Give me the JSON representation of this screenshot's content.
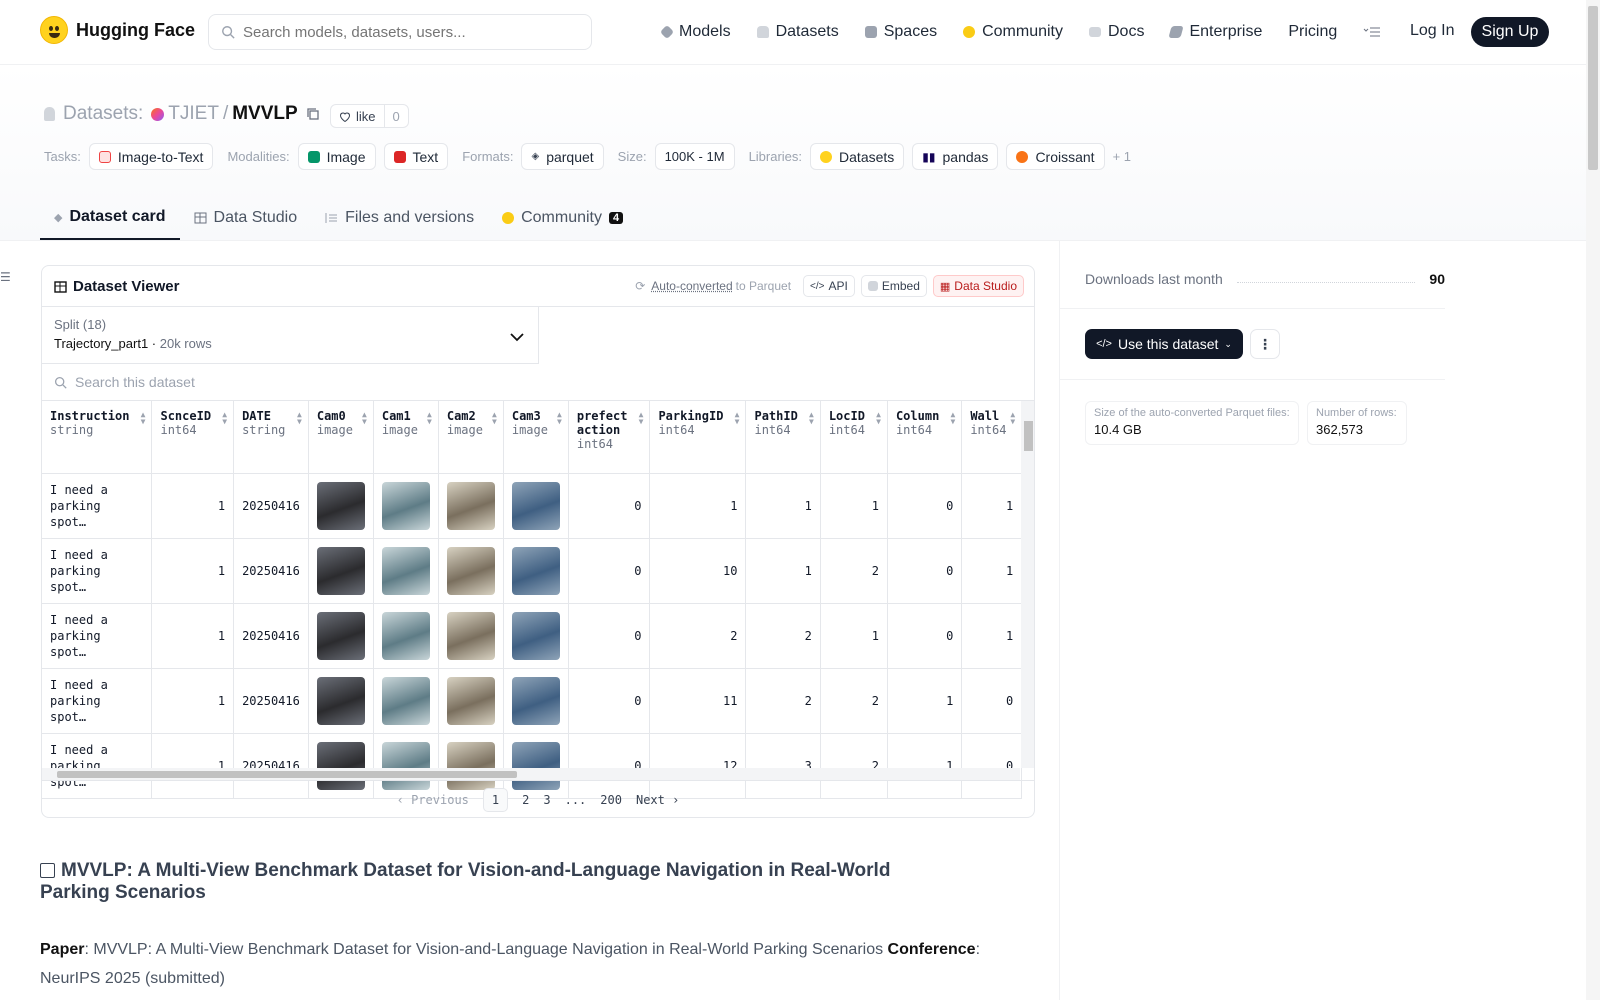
{
  "nav": {
    "brand": "Hugging Face",
    "search_placeholder": "Search models, datasets, users...",
    "items": [
      {
        "label": "Models",
        "color": "#9ca3af"
      },
      {
        "label": "Datasets",
        "color": "#d1d5db"
      },
      {
        "label": "Spaces",
        "color": "#9ca3af"
      },
      {
        "label": "Community",
        "color": "#facc15"
      },
      {
        "label": "Docs",
        "color": "#d1d5db"
      },
      {
        "label": "Enterprise",
        "color": "#9ca3af"
      },
      {
        "label": "Pricing",
        "color": ""
      }
    ],
    "login": "Log In",
    "signup": "Sign Up"
  },
  "repo": {
    "section": "Datasets:",
    "org": "TJIET",
    "name": "MVVLP",
    "like_label": "like",
    "like_count": "0"
  },
  "tags": {
    "tasks_label": "Tasks:",
    "tasks": [
      "Image-to-Text"
    ],
    "modalities_label": "Modalities:",
    "modalities": [
      "Image",
      "Text"
    ],
    "formats_label": "Formats:",
    "formats": [
      "parquet"
    ],
    "size_label": "Size:",
    "size": "100K - 1M",
    "libraries_label": "Libraries:",
    "libraries": [
      "Datasets",
      "pandas",
      "Croissant"
    ],
    "more": "+ 1"
  },
  "tabs": [
    {
      "label": "Dataset card",
      "active": true
    },
    {
      "label": "Data Studio"
    },
    {
      "label": "Files and versions"
    },
    {
      "label": "Community",
      "badge": "4"
    }
  ],
  "viewer": {
    "title": "Dataset Viewer",
    "auto_converted": "Auto-converted",
    "to_parquet": "to Parquet",
    "api": "API",
    "embed": "Embed",
    "data_studio": "Data Studio",
    "split_label": "Split (18)",
    "split_value": "Trajectory_part1",
    "split_rows": "20k rows",
    "search_placeholder": "Search this dataset",
    "columns": [
      {
        "name": "Instruction",
        "type": "string",
        "w": 108
      },
      {
        "name": "ScnceID",
        "type": "int64",
        "w": 81
      },
      {
        "name": "DATE",
        "type": "string",
        "w": 72
      },
      {
        "name": "Cam0",
        "type": "image",
        "w": 64
      },
      {
        "name": "Cam1",
        "type": "image",
        "w": 63
      },
      {
        "name": "Cam2",
        "type": "image",
        "w": 64
      },
      {
        "name": "Cam3",
        "type": "image",
        "w": 64
      },
      {
        "name": "prefect action",
        "type": "int64",
        "w": 81
      },
      {
        "name": "ParkingID",
        "type": "int64",
        "w": 95
      },
      {
        "name": "PathID",
        "type": "int64",
        "w": 74
      },
      {
        "name": "LocID",
        "type": "int64",
        "w": 67
      },
      {
        "name": "Column",
        "type": "int64",
        "w": 74
      },
      {
        "name": "Wall",
        "type": "int64",
        "w": 52
      }
    ],
    "rows": [
      [
        "I need a parking spot…",
        "1",
        "20250416",
        "",
        "",
        "",
        "",
        "0",
        "1",
        "1",
        "1",
        "0",
        "1"
      ],
      [
        "I need a parking spot…",
        "1",
        "20250416",
        "",
        "",
        "",
        "",
        "0",
        "10",
        "1",
        "2",
        "0",
        "1"
      ],
      [
        "I need a parking spot…",
        "1",
        "20250416",
        "",
        "",
        "",
        "",
        "0",
        "2",
        "2",
        "1",
        "0",
        "1"
      ],
      [
        "I need a parking spot…",
        "1",
        "20250416",
        "",
        "",
        "",
        "",
        "0",
        "11",
        "2",
        "2",
        "1",
        "0"
      ],
      [
        "I need a parking spot…",
        "1",
        "20250416",
        "",
        "",
        "",
        "",
        "0",
        "12",
        "3",
        "2",
        "1",
        "0"
      ]
    ],
    "pager": {
      "prev": "Previous",
      "pages": [
        "1",
        "2",
        "3",
        "...",
        "200"
      ],
      "next": "Next"
    }
  },
  "readme": {
    "title": "MVVLP: A Multi-View Benchmark Dataset for Vision-and-Language Navigation in Real-World Parking Scenarios",
    "paper_label": "Paper",
    "paper_text": ": MVVLP: A Multi-View Benchmark Dataset for Vision-and-Language Navigation in Real-World Parking Scenarios ",
    "conf_label": "Conference",
    "conf_text": ": NeurIPS 2025 (submitted)"
  },
  "sidebar": {
    "downloads_label": "Downloads last month",
    "downloads": "90",
    "use_dataset": "Use this dataset",
    "parquet_size_label": "Size of the auto-converted Parquet files:",
    "parquet_size": "10.4 GB",
    "rows_label": "Number of rows:",
    "rows": "362,573"
  }
}
